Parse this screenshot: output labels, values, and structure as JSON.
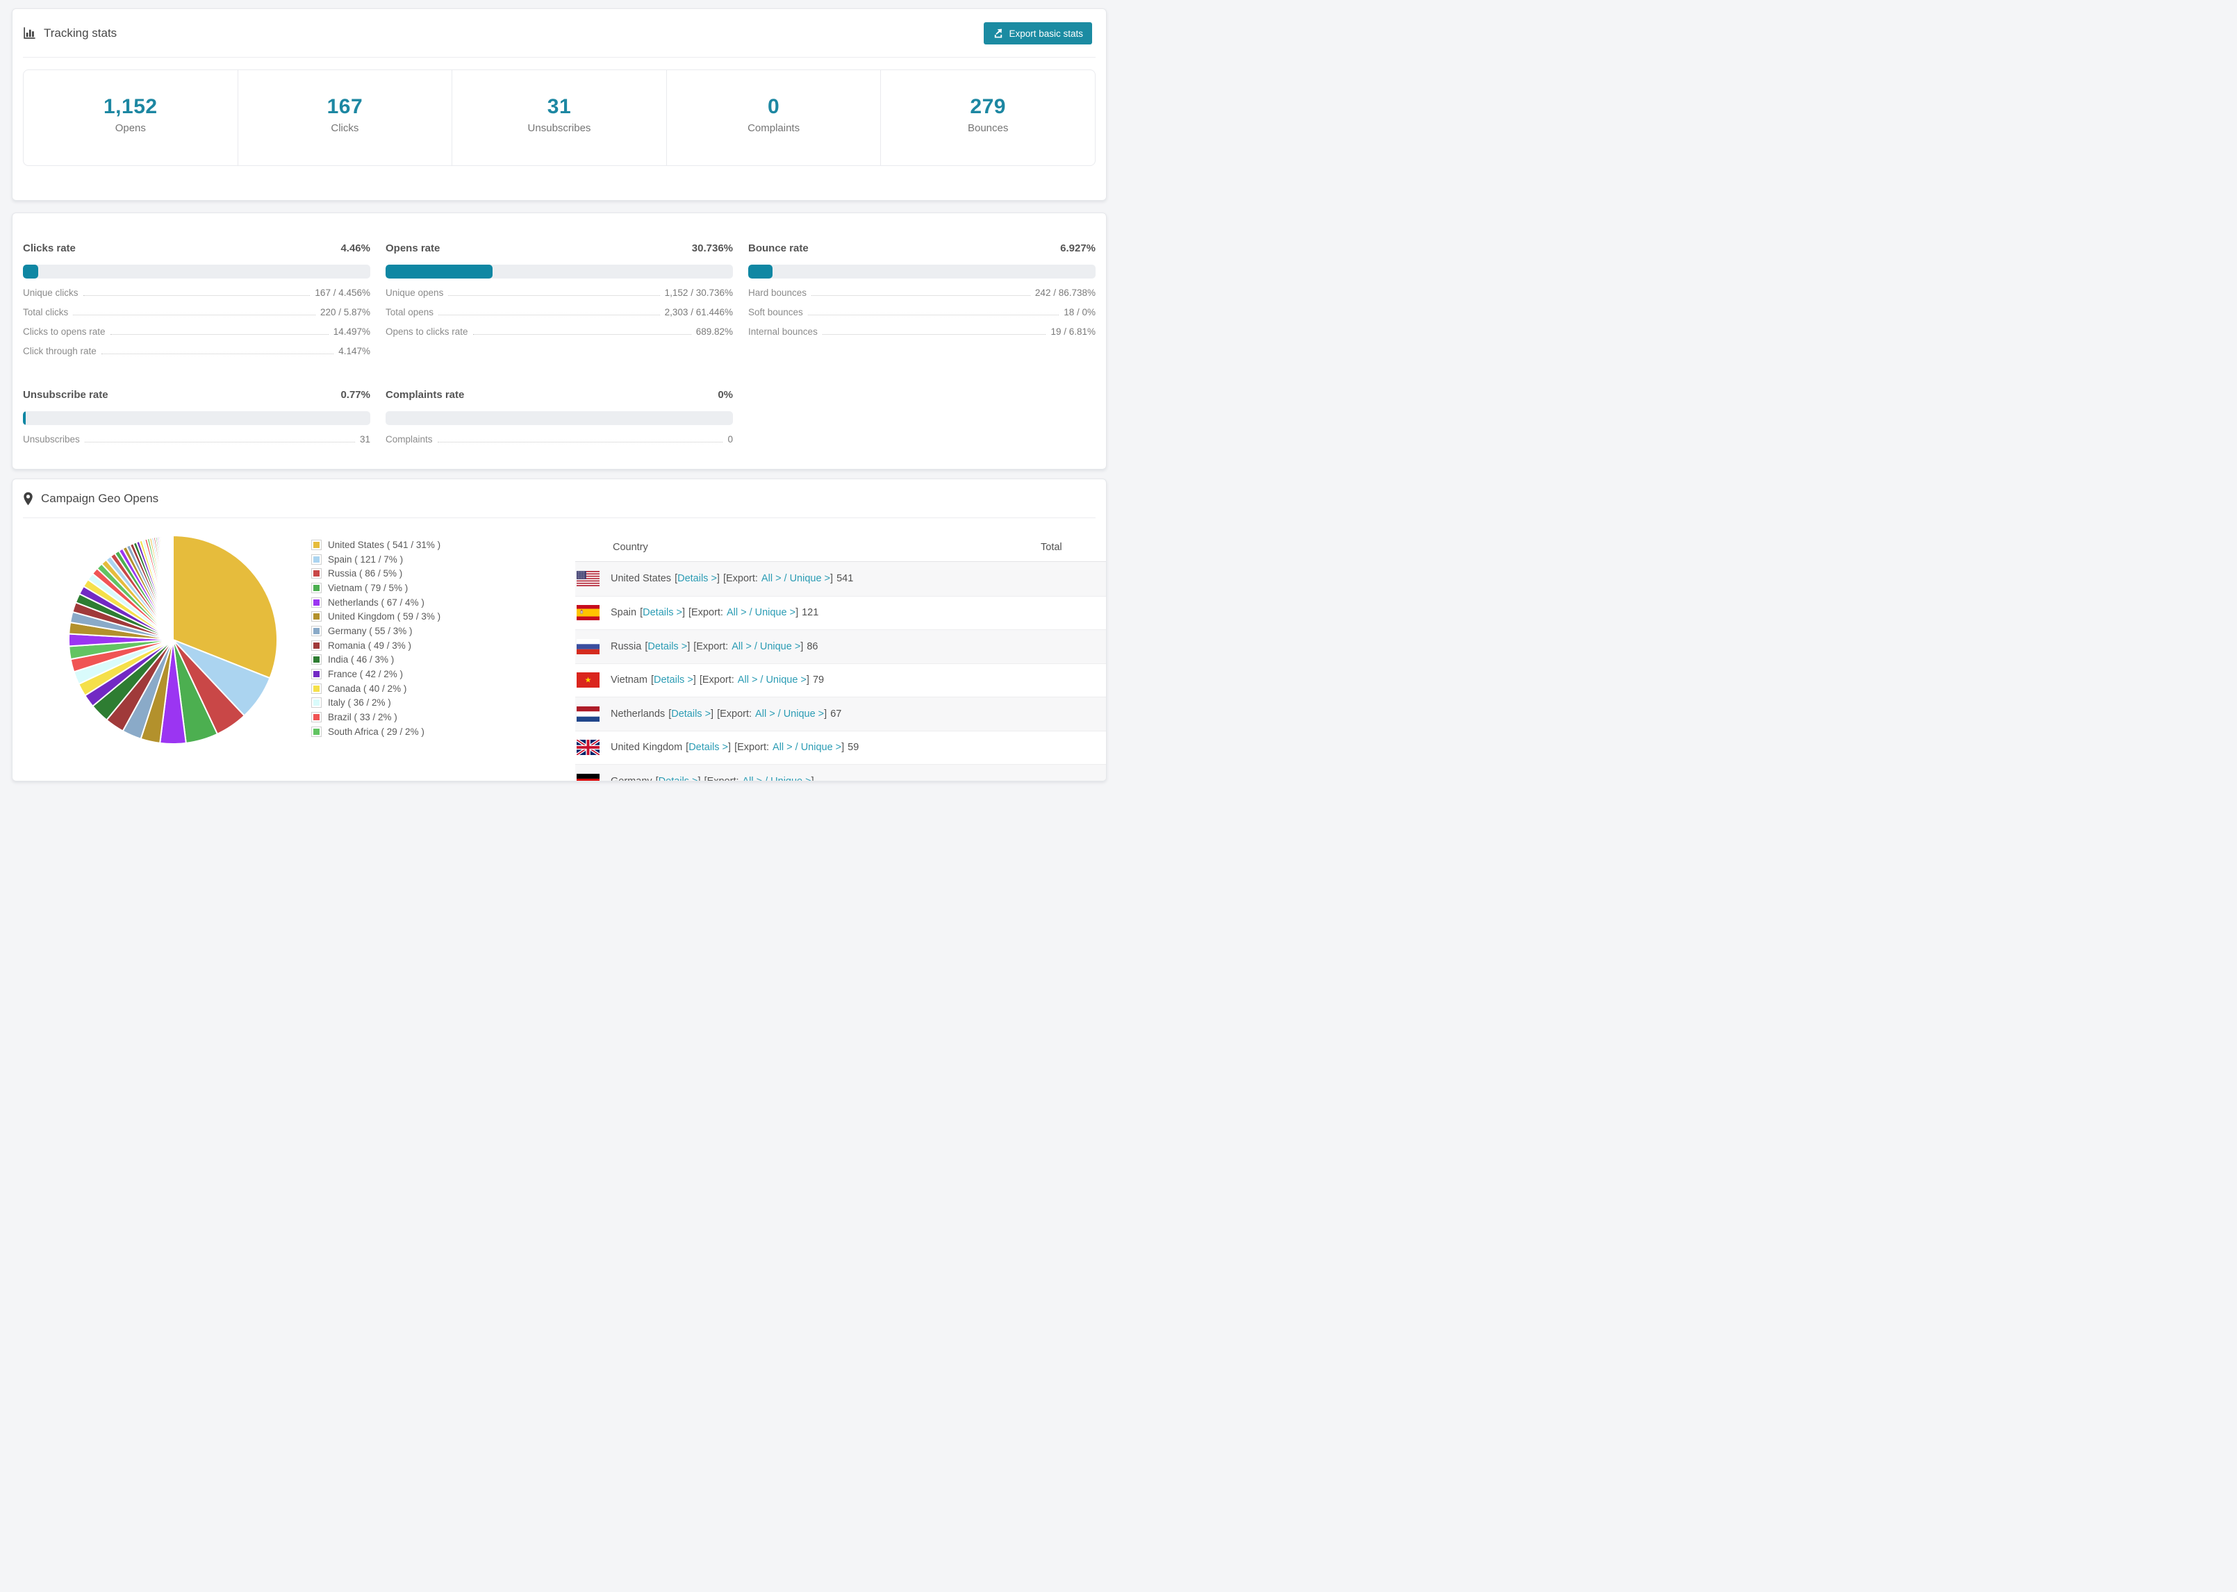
{
  "colors": {
    "accent": "#1d87a2",
    "accent_bar": "#0f87a3",
    "link": "#2b9cb4",
    "button_bg": "#1b8ba2"
  },
  "tracking": {
    "title": "Tracking stats",
    "export_button_label": "Export basic stats",
    "stats": [
      {
        "value": "1,152",
        "label": "Opens"
      },
      {
        "value": "167",
        "label": "Clicks"
      },
      {
        "value": "31",
        "label": "Unsubscribes"
      },
      {
        "value": "0",
        "label": "Complaints"
      },
      {
        "value": "279",
        "label": "Bounces"
      }
    ]
  },
  "rates": {
    "sections": [
      {
        "title": "Clicks rate",
        "value": "4.46%",
        "percent": 4.46,
        "rows": [
          {
            "label": "Unique clicks",
            "value": "167 / 4.456%"
          },
          {
            "label": "Total clicks",
            "value": "220 / 5.87%"
          },
          {
            "label": "Clicks to opens rate",
            "value": "14.497%"
          },
          {
            "label": "Click through rate",
            "value": "4.147%"
          }
        ]
      },
      {
        "title": "Opens rate",
        "value": "30.736%",
        "percent": 30.736,
        "rows": [
          {
            "label": "Unique opens",
            "value": "1,152 / 30.736%"
          },
          {
            "label": "Total opens",
            "value": "2,303 / 61.446%"
          },
          {
            "label": "Opens to clicks rate",
            "value": "689.82%"
          }
        ]
      },
      {
        "title": "Bounce rate",
        "value": "6.927%",
        "percent": 6.927,
        "rows": [
          {
            "label": "Hard bounces",
            "value": "242 / 86.738%"
          },
          {
            "label": "Soft bounces",
            "value": "18 / 0%"
          },
          {
            "label": "Internal bounces",
            "value": "19 / 6.81%"
          }
        ]
      },
      {
        "title": "Unsubscribe rate",
        "value": "0.77%",
        "percent": 0.77,
        "rows": [
          {
            "label": "Unsubscribes",
            "value": "31"
          }
        ]
      },
      {
        "title": "Complaints rate",
        "value": "0%",
        "percent": 0,
        "rows": [
          {
            "label": "Complaints",
            "value": "0"
          }
        ]
      }
    ]
  },
  "geo": {
    "title": "Campaign Geo Opens",
    "table": {
      "headers": {
        "country": "Country",
        "total": "Total"
      },
      "labels": {
        "lb": "[",
        "rb": "]",
        "details": "Details >",
        "export": "Export:",
        "all": "All >",
        "slash": "/",
        "unique": "Unique >"
      },
      "rows": [
        {
          "country": "United States",
          "flag": "us",
          "total": "541"
        },
        {
          "country": "Spain",
          "flag": "es",
          "total": "121"
        },
        {
          "country": "Russia",
          "flag": "ru",
          "total": "86"
        },
        {
          "country": "Vietnam",
          "flag": "vn",
          "total": "79"
        },
        {
          "country": "Netherlands",
          "flag": "nl",
          "total": "67"
        },
        {
          "country": "United Kingdom",
          "flag": "gb",
          "total": "59"
        },
        {
          "country": "Germany",
          "flag": "de",
          "total": ""
        }
      ]
    }
  },
  "chart_data": {
    "type": "pie",
    "title": "Campaign Geo Opens",
    "legend_position": "right",
    "start_angle": "top",
    "direction": "clockwise",
    "slices": [
      {
        "label": "United States",
        "value": 541,
        "percent": 31,
        "color": "#e6bc3c",
        "legend_label": "United States ( 541 / 31% )"
      },
      {
        "label": "Spain",
        "value": 121,
        "percent": 7,
        "color": "#abd4f0",
        "legend_label": "Spain ( 121 / 7% )"
      },
      {
        "label": "Russia",
        "value": 86,
        "percent": 5,
        "color": "#c94747",
        "legend_label": "Russia ( 86 / 5% )"
      },
      {
        "label": "Vietnam",
        "value": 79,
        "percent": 5,
        "color": "#4caf50",
        "legend_label": "Vietnam ( 79 / 5% )"
      },
      {
        "label": "Netherlands",
        "value": 67,
        "percent": 4,
        "color": "#9b35f2",
        "legend_label": "Netherlands ( 67 / 4% )"
      },
      {
        "label": "United Kingdom",
        "value": 59,
        "percent": 3,
        "color": "#b3912c",
        "legend_label": "United Kingdom ( 59 / 3% )"
      },
      {
        "label": "Germany",
        "value": 55,
        "percent": 3,
        "color": "#8aaac8",
        "legend_label": "Germany ( 55 / 3% )"
      },
      {
        "label": "Romania",
        "value": 49,
        "percent": 3,
        "color": "#a03a3a",
        "legend_label": "Romania ( 49 / 3% )"
      },
      {
        "label": "India",
        "value": 46,
        "percent": 3,
        "color": "#2e7d32",
        "legend_label": "India ( 46 / 3% )"
      },
      {
        "label": "France",
        "value": 42,
        "percent": 2,
        "color": "#7229c4",
        "legend_label": "France ( 42 / 2% )"
      },
      {
        "label": "Canada",
        "value": 40,
        "percent": 2,
        "color": "#f5e04a",
        "legend_label": "Canada ( 40 / 2% )"
      },
      {
        "label": "Italy",
        "value": 36,
        "percent": 2,
        "color": "#d9fbfb",
        "legend_label": "Italy ( 36 / 2% )"
      },
      {
        "label": "Brazil",
        "value": 33,
        "percent": 2,
        "color": "#f05454",
        "legend_label": "Brazil ( 33 / 2% )"
      },
      {
        "label": "South Africa",
        "value": 29,
        "percent": 2,
        "color": "#62c462",
        "legend_label": "South Africa ( 29 / 2% )"
      }
    ],
    "others": {
      "note": "remaining countries drawn as many small unlabeled slices fanning to the top",
      "percent_total": 26,
      "count": 44,
      "decay": 0.93,
      "palette_start_index": 4
    }
  }
}
